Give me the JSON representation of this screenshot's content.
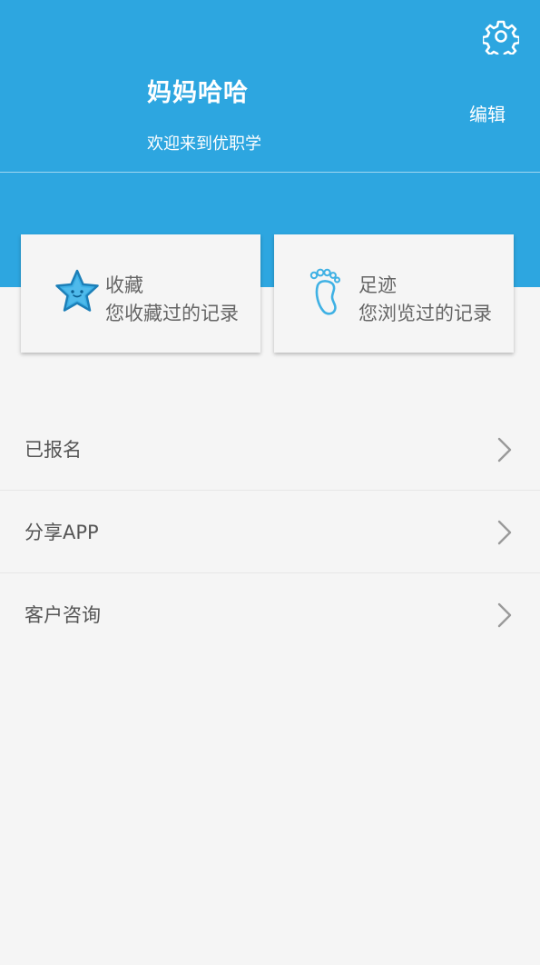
{
  "header": {
    "username": "妈妈哈哈",
    "welcome": "欢迎来到优职学",
    "edit_label": "编辑",
    "settings_icon": "gear-icon",
    "bg_color": "#2da6e0"
  },
  "cards": [
    {
      "title": "收藏",
      "desc": "您收藏过的记录",
      "icon": "star-icon"
    },
    {
      "title": "足迹",
      "desc": "您浏览过的记录",
      "icon": "footprint-icon"
    }
  ],
  "menu": {
    "items": [
      {
        "label": "已报名"
      },
      {
        "label": "分享APP"
      },
      {
        "label": "客户咨询"
      }
    ],
    "chevron_icon": "chevron-right-icon"
  }
}
